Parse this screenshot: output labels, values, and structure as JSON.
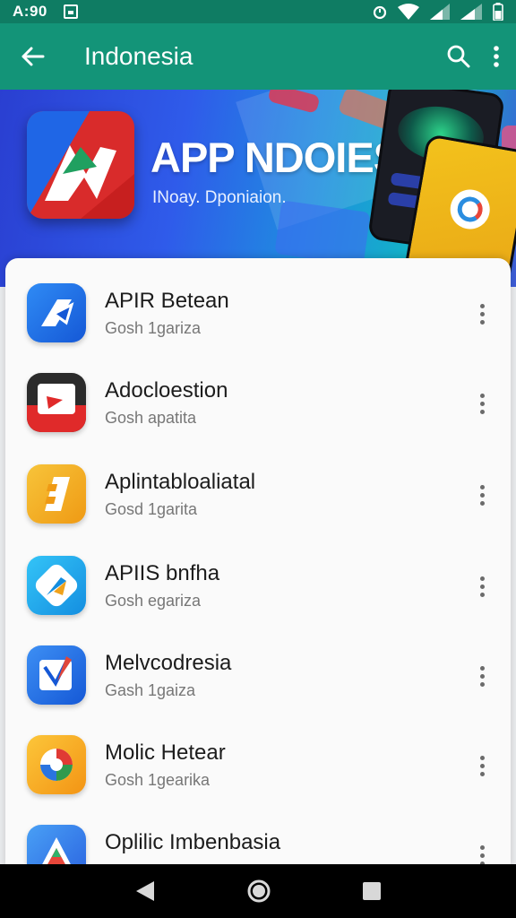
{
  "status_bar": {
    "time": "A:90"
  },
  "app_bar": {
    "title": "Indonesia"
  },
  "banner": {
    "title": "APP NDOIESIA",
    "subtitle": "INoay. Dponiaion."
  },
  "apps": [
    {
      "name": "APIR Betean",
      "sub": "Gosh 1gariza",
      "icon": "arrow-app-icon",
      "colors": [
        "#1e6fe8",
        "#2f8bf5"
      ]
    },
    {
      "name": "Adocloestion",
      "sub": "Gosh apatita",
      "icon": "video-app-icon",
      "colors": [
        "#e02a2a",
        "#2b2b2b"
      ]
    },
    {
      "name": "Aplintabloaliatal",
      "sub": "Gosd 1garita",
      "icon": "block-app-icon",
      "colors": [
        "#f0a81b",
        "#f5c23a"
      ]
    },
    {
      "name": "APIIS bnfha",
      "sub": "Gosh egariza",
      "icon": "compass-app-icon",
      "colors": [
        "#1aa0e8",
        "#2fc0f5"
      ]
    },
    {
      "name": "Melvcodresia",
      "sub": "Gash 1gaiza",
      "icon": "edit-app-icon",
      "colors": [
        "#1f6ee6",
        "#3d8ff4"
      ]
    },
    {
      "name": "Molic Hetear",
      "sub": "Gosh 1gearika",
      "icon": "swirl-app-icon",
      "colors": [
        "#f5a01a",
        "#fbc13a"
      ]
    },
    {
      "name": "Oplilic Imbenbasia",
      "sub": "",
      "icon": "triangle-app-icon",
      "colors": [
        "#2a68e0",
        "#49a0f5"
      ]
    }
  ]
}
